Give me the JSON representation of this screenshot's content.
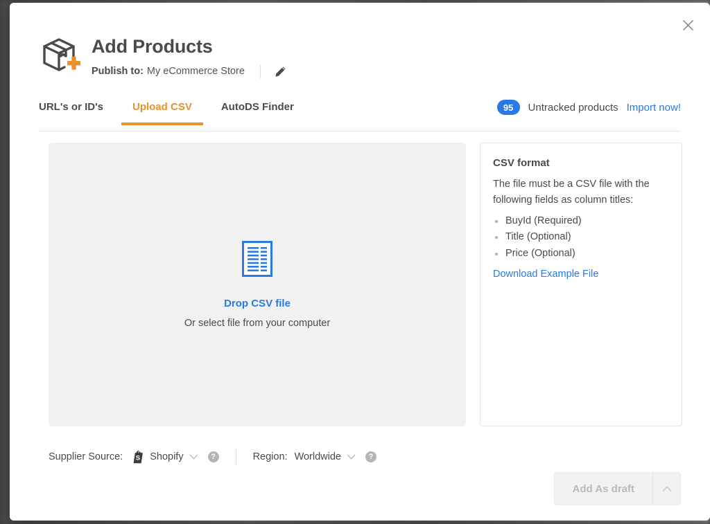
{
  "modal": {
    "close_icon": "close-icon",
    "title": "Add Products",
    "publish_label": "Publish to:",
    "publish_value": "My eCommerce Store",
    "edit_icon": "pencil-icon",
    "brand_icon": "package-add-icon"
  },
  "tabs": [
    {
      "label": "URL's or ID's",
      "active": false
    },
    {
      "label": "Upload CSV",
      "active": true
    },
    {
      "label": "AutoDS Finder",
      "active": false
    }
  ],
  "untracked": {
    "count": "95",
    "label": "Untracked products",
    "action": "Import now!"
  },
  "dropzone": {
    "icon": "csv-file-icon",
    "title": "Drop CSV file",
    "subtitle": "Or select file from your computer"
  },
  "csv_format": {
    "heading": "CSV format",
    "description": "The file must be a CSV file with the following fields as column titles:",
    "fields": [
      "BuyId (Required)",
      "Title (Optional)",
      "Price (Optional)"
    ],
    "download_link": "Download Example File"
  },
  "footer": {
    "supplier_label": "Supplier Source:",
    "supplier_value": "Shopify",
    "supplier_icon": "shopify-icon",
    "region_label": "Region:",
    "region_value": "Worldwide",
    "help_icon": "help-icon",
    "chevron_icon": "chevron-down-icon"
  },
  "submit": {
    "label": "Add As draft",
    "caret_icon": "chevron-up-icon"
  },
  "colors": {
    "accent_orange": "#e8922b",
    "link_blue": "#2979e8",
    "badge_blue": "#2979e8",
    "text_dark": "#4a4a4a",
    "dropzone_bg": "#f1f1f1"
  }
}
